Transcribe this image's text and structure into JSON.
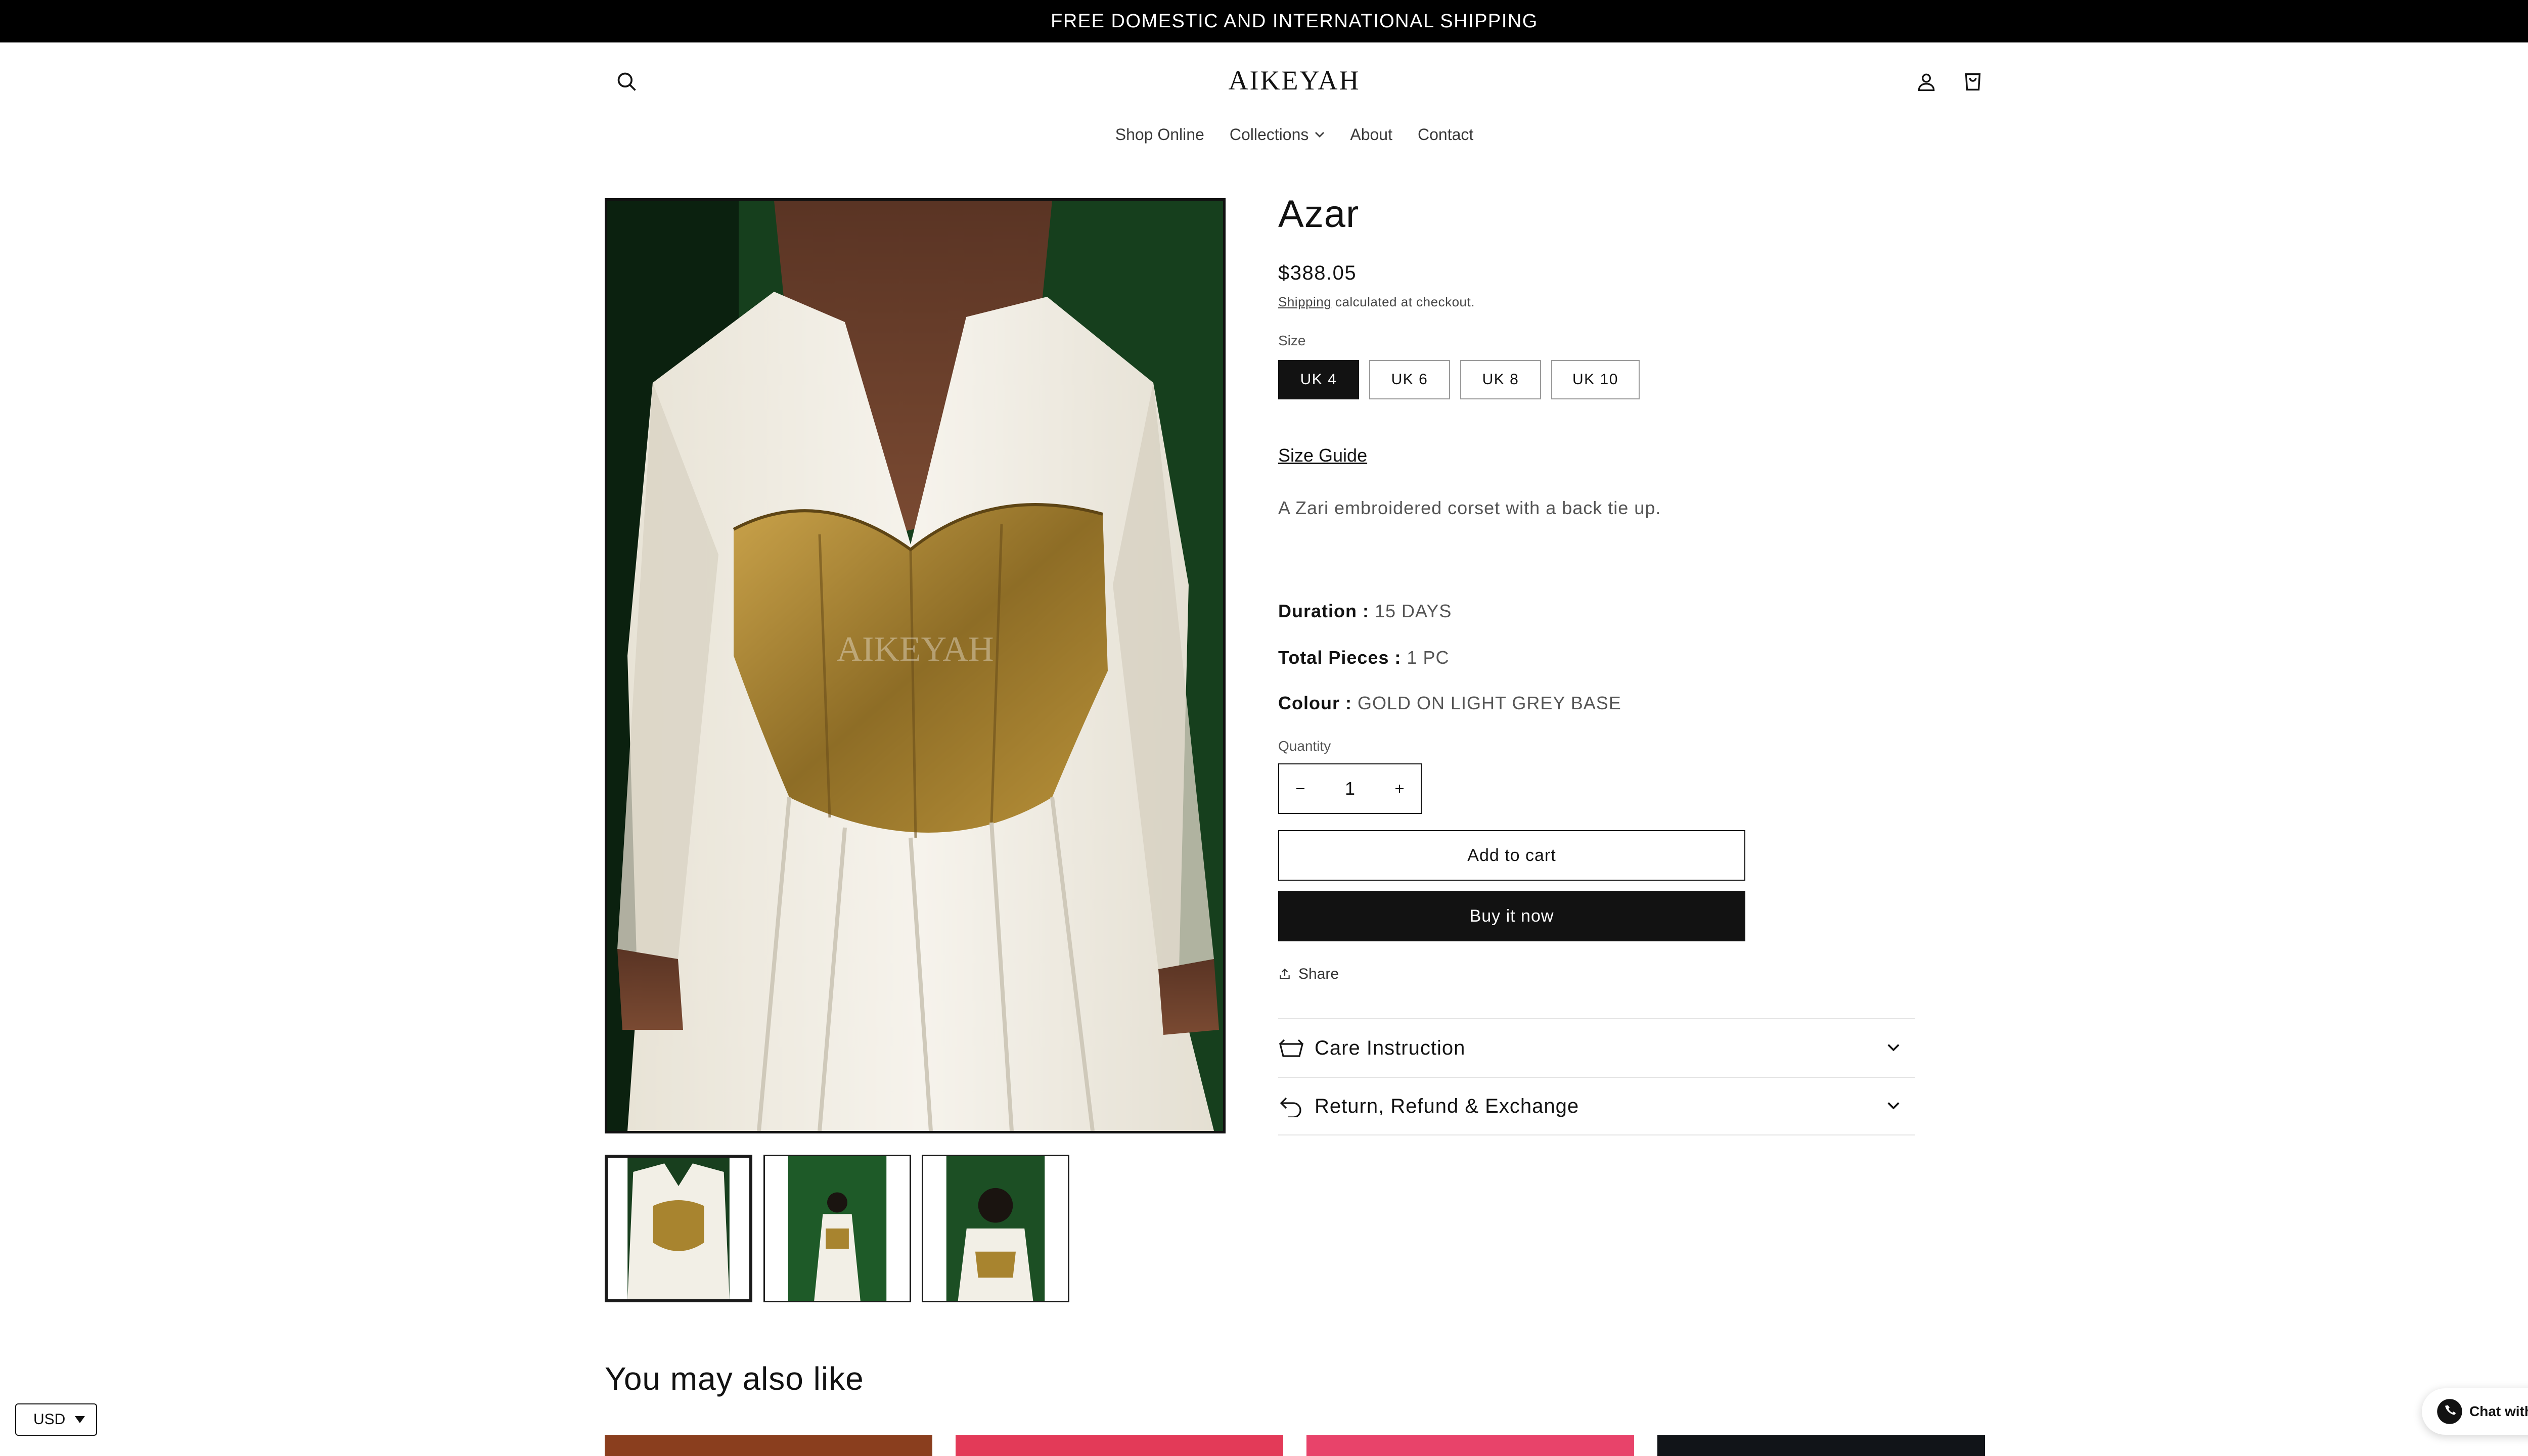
{
  "announcement": "FREE DOMESTIC AND INTERNATIONAL SHIPPING",
  "header": {
    "logo": "AIKEYAH",
    "icons": [
      "search-icon",
      "account-icon",
      "cart-icon"
    ]
  },
  "nav": {
    "items": [
      {
        "label": "Shop Online"
      },
      {
        "label": "Collections"
      },
      {
        "label": "About"
      },
      {
        "label": "Contact"
      }
    ]
  },
  "gallery": {
    "watermark": "AIKEYAH",
    "thumbnail_count": 3,
    "selected_thumbnail": 1
  },
  "product": {
    "title": "Azar",
    "price": "$388.05",
    "shipping_link": "Shipping",
    "shipping_text": "calculated at checkout.",
    "size_label": "Size",
    "sizes": [
      "UK 4",
      "UK 6",
      "UK 8",
      "UK 10"
    ],
    "selected_size": "UK 4",
    "size_guide": "Size Guide",
    "description": "A Zari embroidered corset with a back tie up.",
    "specs": {
      "duration_label": "Duration :",
      "duration": "15 DAYS",
      "pieces_label": "Total Pieces :",
      "pieces": "1 PC",
      "colour_label": "Colour :",
      "colour": "GOLD ON LIGHT GREY BASE"
    },
    "quantity_label": "Quantity",
    "quantity": "1",
    "add_to_cart": "Add to cart",
    "buy_now": "Buy it now",
    "share": "Share",
    "accordions": [
      {
        "label": "Care Instruction",
        "icon": "basket-icon"
      },
      {
        "label": "Return, Refund & Exchange",
        "icon": "return-arrow-icon"
      }
    ]
  },
  "recommendations": {
    "heading": "You may also like"
  },
  "currency": {
    "selected": "USD"
  },
  "chat": {
    "label": "Chat with us"
  },
  "colors": {
    "announcement_bg": "#000000",
    "primary": "#121212",
    "dress_green": "#1c4a22",
    "corset_gold": "#a8842f",
    "dress_white": "#f2efe6"
  }
}
